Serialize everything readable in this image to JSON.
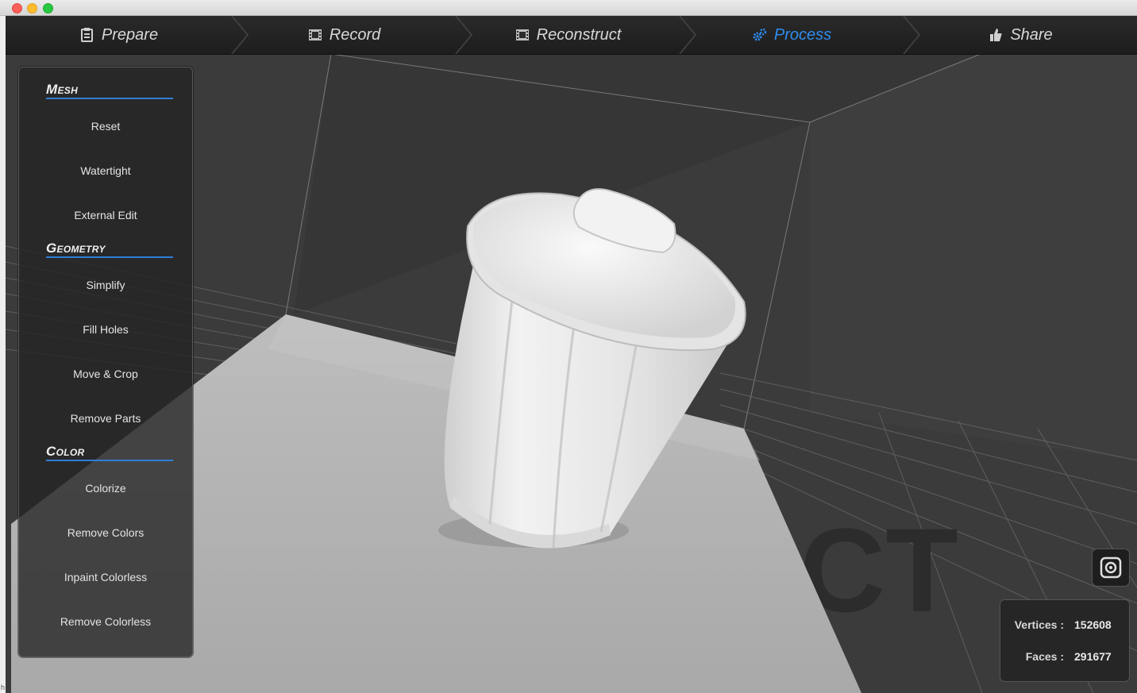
{
  "window": {
    "close": "close",
    "minimize": "minimize",
    "maximize": "maximize"
  },
  "nav": {
    "steps": [
      {
        "label": "Prepare",
        "icon": "clipboard-icon"
      },
      {
        "label": "Record",
        "icon": "film-icon"
      },
      {
        "label": "Reconstruct",
        "icon": "film-icon"
      },
      {
        "label": "Process",
        "icon": "gears-icon",
        "active": true
      },
      {
        "label": "Share",
        "icon": "thumbs-up-icon"
      }
    ],
    "active_color": "#2f8df0"
  },
  "panel": {
    "mesh": {
      "title": "Mesh",
      "items": [
        "Reset",
        "Watertight",
        "External Edit"
      ]
    },
    "geometry": {
      "title": "Geometry",
      "items": [
        "Simplify",
        "Fill Holes",
        "Move & Crop",
        "Remove Parts"
      ]
    },
    "color": {
      "title": "Color",
      "items": [
        "Colorize",
        "Remove Colors",
        "Inpaint Colorless",
        "Remove Colorless"
      ]
    }
  },
  "stats": {
    "vertices_label": "Vertices :",
    "vertices_value": "152608",
    "faces_label": "Faces :",
    "faces_value": "291677"
  },
  "watermark": "CT",
  "camera_button": "camera-icon",
  "colors": {
    "accent": "#2f7ed8",
    "viewport_bg": "#3a3a3a",
    "panel_bg": "#222222"
  }
}
